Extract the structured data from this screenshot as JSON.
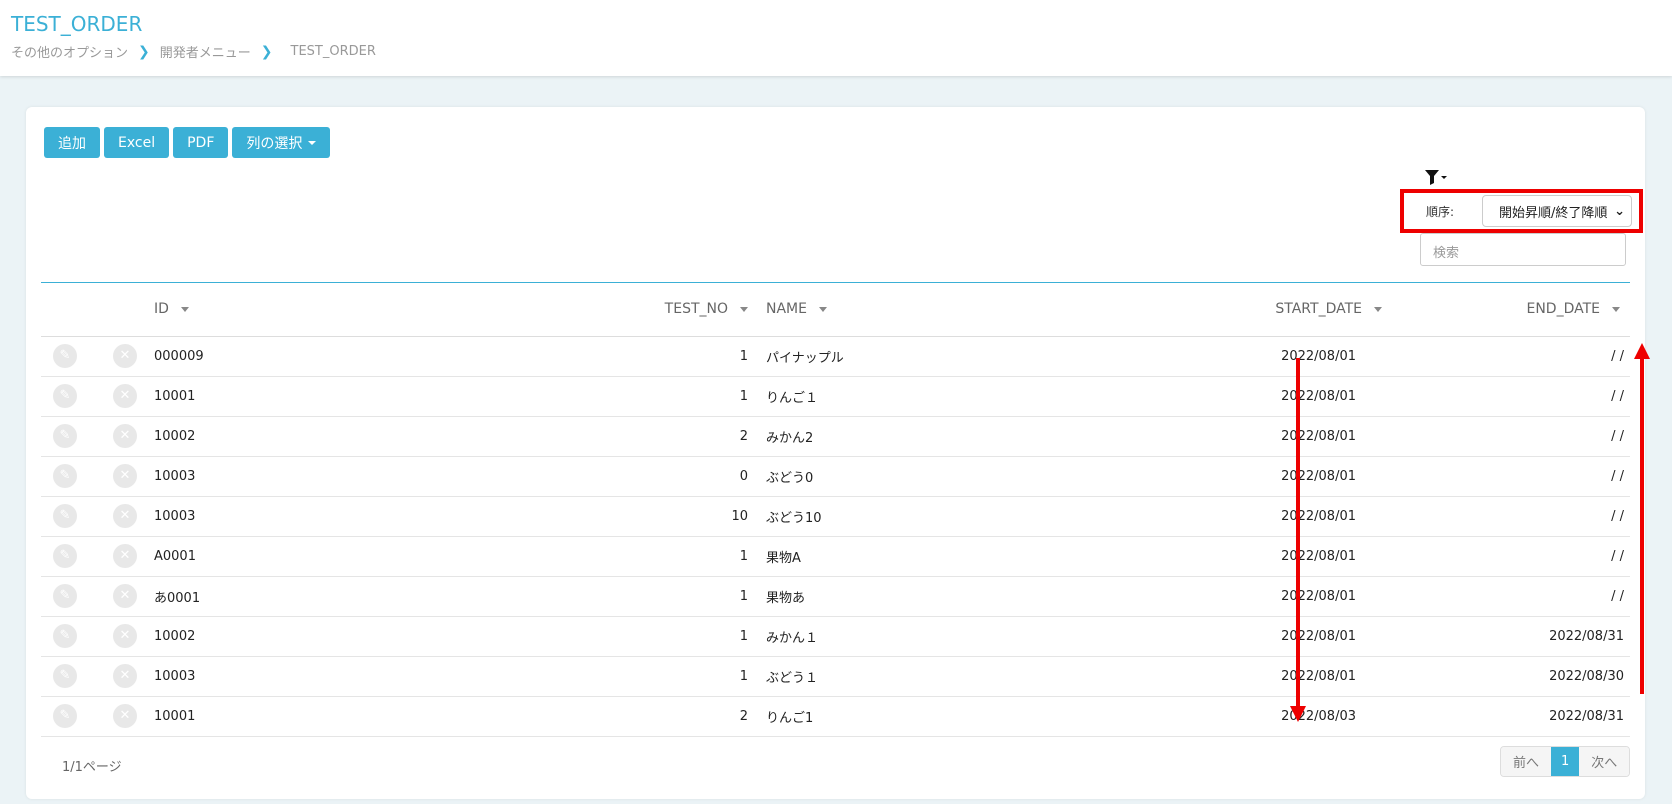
{
  "header": {
    "title": "TEST_ORDER",
    "breadcrumb": [
      "その他のオプション",
      "開発者メニュー",
      "TEST_ORDER"
    ]
  },
  "toolbar": {
    "add": "追加",
    "excel": "Excel",
    "pdf": "PDF",
    "columns": "列の選択"
  },
  "order": {
    "label": "順序:",
    "value": "開始昇順/終了降順"
  },
  "search": {
    "placeholder": "検索"
  },
  "table": {
    "headers": [
      "ID",
      "TEST_NO",
      "NAME",
      "START_DATE",
      "END_DATE"
    ],
    "rows": [
      [
        "000009",
        "1",
        "パイナップル",
        "2022/08/01",
        "/ /"
      ],
      [
        "10001",
        "1",
        "りんご１",
        "2022/08/01",
        "/ /"
      ],
      [
        "10002",
        "2",
        "みかん2",
        "2022/08/01",
        "/ /"
      ],
      [
        "10003",
        "0",
        "ぶどう0",
        "2022/08/01",
        "/ /"
      ],
      [
        "10003",
        "10",
        "ぶどう10",
        "2022/08/01",
        "/ /"
      ],
      [
        "A0001",
        "1",
        "果物A",
        "2022/08/01",
        "/ /"
      ],
      [
        "あ0001",
        "1",
        "果物あ",
        "2022/08/01",
        "/ /"
      ],
      [
        "10002",
        "1",
        "みかん１",
        "2022/08/01",
        "2022/08/31"
      ],
      [
        "10003",
        "1",
        "ぶどう１",
        "2022/08/01",
        "2022/08/30"
      ],
      [
        "10001",
        "2",
        "りんご1",
        "2022/08/03",
        "2022/08/31"
      ]
    ]
  },
  "pagination": {
    "info": "1/1ページ",
    "prev": "前へ",
    "current": "1",
    "next": "次へ"
  }
}
